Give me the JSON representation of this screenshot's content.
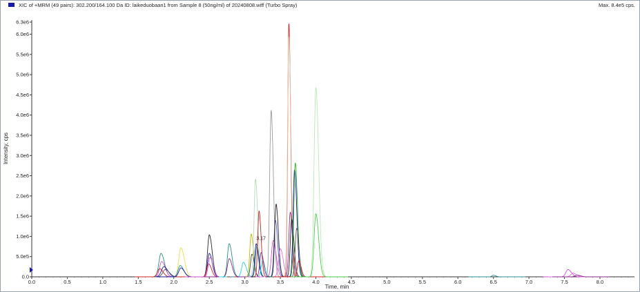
{
  "header": {
    "title": "XIC of +MRM (49 pairs): 302.200/164.100 Da ID: laikeduobaan1 from Sample 8 (50ng/ml) of 20240808.wiff (Turbo Spray)",
    "max_label": "Max. 8.4e5 cps."
  },
  "colors": {
    "marker": "#1a1aa8",
    "axis": "#333333"
  },
  "chart_data": {
    "type": "line",
    "title": "",
    "xlabel": "Time, min",
    "ylabel": "Intensity, cps",
    "xlim": [
      0,
      8.5
    ],
    "ylim": [
      0,
      6300000.0
    ],
    "x_ticks": [
      0.0,
      0.5,
      1.0,
      1.5,
      2.0,
      2.5,
      3.0,
      3.5,
      4.0,
      4.5,
      5.0,
      5.5,
      6.0,
      6.5,
      7.0,
      7.5,
      8.0
    ],
    "x_tick_labels": [
      "0.0",
      "0.5",
      "1.0",
      "1.5",
      "2.0",
      "2.5",
      "3.0",
      "3.5",
      "4.0",
      "4.5",
      "5.0",
      "5.5",
      "6.0",
      "6.5",
      "7.0",
      "7.5",
      "8.0"
    ],
    "y_ticks": [
      0,
      500000,
      1000000,
      1500000,
      2000000,
      2500000,
      3000000,
      3500000,
      4000000,
      4500000,
      5000000,
      5500000,
      6000000,
      6300000
    ],
    "y_tick_labels": [
      "0.0",
      "5.0e5",
      "1.0e6",
      "1.5e6",
      "2.0e6",
      "2.5e6",
      "3.0e6",
      "3.5e6",
      "4.0e6",
      "4.5e6",
      "5.0e6",
      "5.5e6",
      "6.0e6",
      "6.3e6"
    ],
    "grid": false,
    "annotations": [
      {
        "text": "3.17",
        "x": 3.17,
        "y": 880000
      }
    ],
    "series": [
      {
        "color": "#2a8f8f",
        "rt": 1.82,
        "height": 580000,
        "width": 0.03
      },
      {
        "color": "#d04fd0",
        "rt": 1.83,
        "height": 380000,
        "width": 0.03
      },
      {
        "color": "#1a1aa8",
        "rt": 1.86,
        "height": 250000,
        "width": 0.035
      },
      {
        "color": "#555555",
        "rt": 1.88,
        "height": 180000,
        "width": 0.035
      },
      {
        "color": "#cc2222",
        "rt": 1.8,
        "height": 200000,
        "width": 0.03
      },
      {
        "color": "#e8e24a",
        "rt": 2.1,
        "height": 720000,
        "width": 0.03
      },
      {
        "color": "#2a8f8f",
        "rt": 2.09,
        "height": 280000,
        "width": 0.03
      },
      {
        "color": "#1a1aa8",
        "rt": 2.1,
        "height": 220000,
        "width": 0.03
      },
      {
        "color": "#222222",
        "rt": 2.5,
        "height": 1040000,
        "width": 0.025
      },
      {
        "color": "#1a1aa8",
        "rt": 2.5,
        "height": 580000,
        "width": 0.025
      },
      {
        "color": "#cc2222",
        "rt": 2.49,
        "height": 320000,
        "width": 0.025
      },
      {
        "color": "#d04fd0",
        "rt": 2.51,
        "height": 480000,
        "width": 0.025
      },
      {
        "color": "#2a8f8f",
        "rt": 2.78,
        "height": 820000,
        "width": 0.025
      },
      {
        "color": "#8a2a8a",
        "rt": 2.78,
        "height": 450000,
        "width": 0.025
      },
      {
        "color": "#27d3e0",
        "rt": 2.98,
        "height": 360000,
        "width": 0.025
      },
      {
        "color": "#b8b800",
        "rt": 3.09,
        "height": 1060000,
        "width": 0.02
      },
      {
        "color": "#444444",
        "rt": 3.1,
        "height": 560000,
        "width": 0.02
      },
      {
        "color": "#b8d8b8",
        "rt": 3.15,
        "height": 2420000,
        "width": 0.02
      },
      {
        "color": "#1a1aa8",
        "rt": 3.16,
        "height": 820000,
        "width": 0.02
      },
      {
        "color": "#2a8f8f",
        "rt": 3.17,
        "height": 760000,
        "width": 0.02
      },
      {
        "color": "#cc2222",
        "rt": 3.2,
        "height": 1630000,
        "width": 0.018
      },
      {
        "color": "#27d3e0",
        "rt": 3.25,
        "height": 420000,
        "width": 0.02
      },
      {
        "color": "#8a2a8a",
        "rt": 3.23,
        "height": 600000,
        "width": 0.02
      },
      {
        "color": "#999999",
        "rt": 3.37,
        "height": 4120000,
        "width": 0.02
      },
      {
        "color": "#d04fd0",
        "rt": 3.4,
        "height": 900000,
        "width": 0.025
      },
      {
        "color": "#5555cc",
        "rt": 3.43,
        "height": 1400000,
        "width": 0.02
      },
      {
        "color": "#222222",
        "rt": 3.44,
        "height": 1800000,
        "width": 0.02
      },
      {
        "color": "#e86ce8",
        "rt": 3.5,
        "height": 700000,
        "width": 0.025
      },
      {
        "color": "#cc2222",
        "rt": 3.62,
        "height": 6280000,
        "width": 0.016
      },
      {
        "color": "#e8c8a8",
        "rt": 3.62,
        "height": 5950000,
        "width": 0.018
      },
      {
        "color": "#8a2a8a",
        "rt": 3.64,
        "height": 1600000,
        "width": 0.02
      },
      {
        "color": "#222222",
        "rt": 3.66,
        "height": 1420000,
        "width": 0.02
      },
      {
        "color": "#1a1aa8",
        "rt": 3.7,
        "height": 2650000,
        "width": 0.02
      },
      {
        "color": "#2fb02f",
        "rt": 3.71,
        "height": 2820000,
        "width": 0.02
      },
      {
        "color": "#555555",
        "rt": 3.73,
        "height": 1200000,
        "width": 0.02
      },
      {
        "color": "#cc2222",
        "rt": 3.76,
        "height": 400000,
        "width": 0.02
      },
      {
        "color": "#b8e8b8",
        "rt": 4.0,
        "height": 4680000,
        "width": 0.025
      },
      {
        "color": "#46d046",
        "rt": 4.0,
        "height": 1560000,
        "width": 0.025
      },
      {
        "color": "#2a8f8f",
        "rt": 6.5,
        "height": 40000,
        "width": 0.02
      },
      {
        "color": "#d04fd0",
        "rt": 7.55,
        "height": 180000,
        "width": 0.03
      },
      {
        "color": "#e86ce8",
        "rt": 7.62,
        "height": 90000,
        "width": 0.03
      },
      {
        "color": "#8a2a8a",
        "rt": 7.68,
        "height": 40000,
        "width": 0.03
      }
    ]
  }
}
